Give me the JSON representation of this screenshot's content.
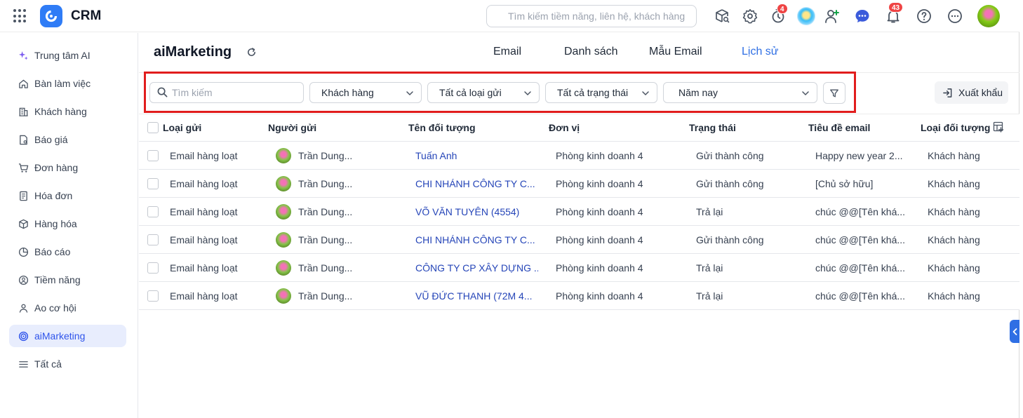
{
  "app": {
    "name": "CRM"
  },
  "topbar": {
    "search_placeholder": "Tìm kiếm tiềm năng, liên hệ, khách hàng",
    "timer_badge": "4",
    "notification_badge": "43"
  },
  "sidebar": {
    "items": [
      {
        "label": "Trung tâm AI",
        "icon": "sparkle-icon"
      },
      {
        "label": "Bàn làm việc",
        "icon": "home-icon"
      },
      {
        "label": "Khách hàng",
        "icon": "building-icon"
      },
      {
        "label": "Báo giá",
        "icon": "quote-doc-icon"
      },
      {
        "label": "Đơn hàng",
        "icon": "cart-icon"
      },
      {
        "label": "Hóa đơn",
        "icon": "invoice-icon"
      },
      {
        "label": "Hàng hóa",
        "icon": "box-icon"
      },
      {
        "label": "Báo cáo",
        "icon": "pie-chart-icon"
      },
      {
        "label": "Tiềm năng",
        "icon": "target-person-icon"
      },
      {
        "label": "Ao cơ hội",
        "icon": "opportunity-icon"
      },
      {
        "label": "aiMarketing",
        "icon": "target-icon",
        "active": true
      },
      {
        "label": "Tất cả",
        "icon": "menu-lines-icon"
      }
    ]
  },
  "page": {
    "title": "aiMarketing",
    "tabs": [
      "Email",
      "Danh sách",
      "Mẫu Email",
      "Lịch sử"
    ],
    "active_tab": "Lịch sử"
  },
  "filters": {
    "search_placeholder": "Tìm kiếm",
    "customer_type": "Khách hàng",
    "send_type": "Tất cả loại gửi",
    "status": "Tất cả trạng thái",
    "period": "Năm nay",
    "export_label": "Xuất khẩu"
  },
  "table": {
    "columns": [
      "Loại gửi",
      "Người gửi",
      "Tên đối tượng",
      "Đơn vị",
      "Trạng thái",
      "Tiêu đề email",
      "Loại đối tượng"
    ],
    "rows": [
      {
        "send_type": "Email hàng loạt",
        "sender": "Trần Dung...",
        "target": "Tuấn Anh",
        "unit": "Phòng kinh doanh 4",
        "status": "Gửi thành công",
        "subject": "Happy new year 2...",
        "target_type": "Khách hàng"
      },
      {
        "send_type": "Email hàng loạt",
        "sender": "Trần Dung...",
        "target": "CHI NHÁNH CÔNG TY C...",
        "unit": "Phòng kinh doanh 4",
        "status": "Gửi thành công",
        "subject": "[Chủ sở hữu]",
        "target_type": "Khách hàng"
      },
      {
        "send_type": "Email hàng loạt",
        "sender": "Trần Dung...",
        "target": "VÕ VĂN TUYÊN (4554)",
        "unit": "Phòng kinh doanh 4",
        "status": "Trả lại",
        "subject": "chúc @@[Tên khá...",
        "target_type": "Khách hàng"
      },
      {
        "send_type": "Email hàng loạt",
        "sender": "Trần Dung...",
        "target": "CHI NHÁNH CÔNG TY C...",
        "unit": "Phòng kinh doanh 4",
        "status": "Gửi thành công",
        "subject": "chúc @@[Tên khá...",
        "target_type": "Khách hàng"
      },
      {
        "send_type": "Email hàng loạt",
        "sender": "Trần Dung...",
        "target": "CÔNG TY CP XÂY DỰNG ...",
        "unit": "Phòng kinh doanh 4",
        "status": "Trả lại",
        "subject": "chúc @@[Tên khá...",
        "target_type": "Khách hàng"
      },
      {
        "send_type": "Email hàng loạt",
        "sender": "Trần Dung...",
        "target": "VŨ ĐỨC THANH (72M 4...",
        "unit": "Phòng kinh doanh 4",
        "status": "Trả lại",
        "subject": "chúc @@[Tên khá...",
        "target_type": "Khách hàng"
      }
    ]
  },
  "colors": {
    "accent": "#2f6fe4",
    "link": "#2545b8",
    "highlight": "#e11d1d",
    "active_nav_bg": "#e8edfd"
  }
}
